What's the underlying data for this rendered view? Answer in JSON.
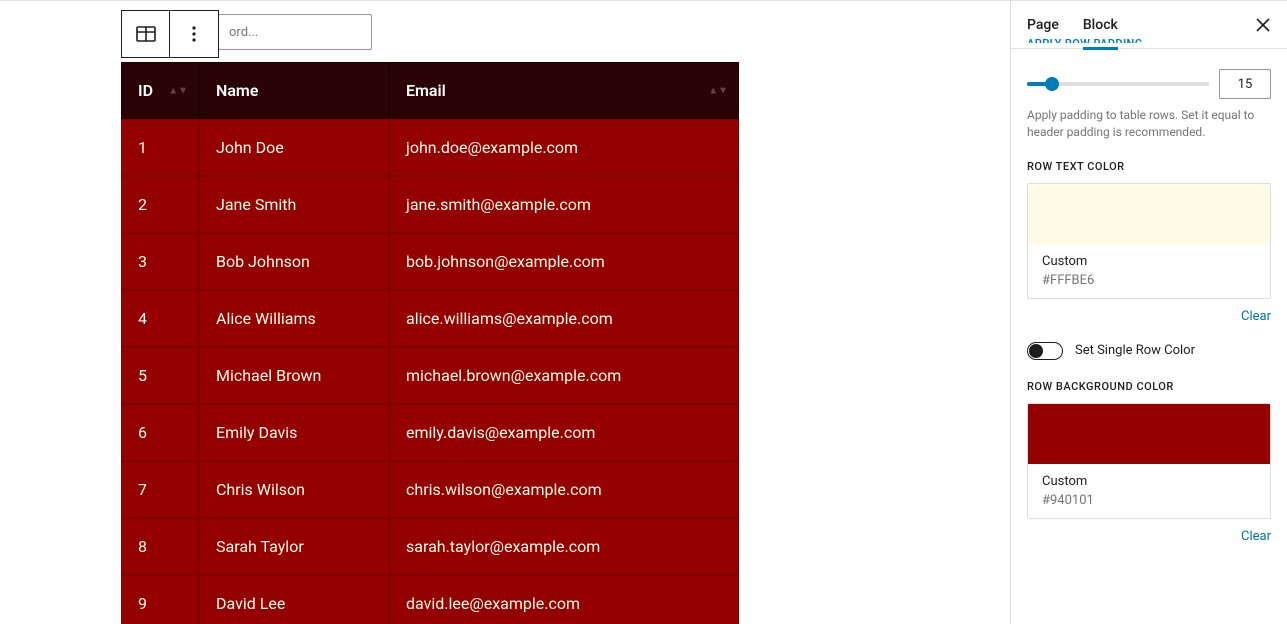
{
  "search": {
    "placeholder": "ord..."
  },
  "table": {
    "headers": {
      "id": "ID",
      "name": "Name",
      "email": "Email"
    },
    "rows": [
      {
        "id": "1",
        "name": "John Doe",
        "email": "john.doe@example.com"
      },
      {
        "id": "2",
        "name": "Jane Smith",
        "email": "jane.smith@example.com"
      },
      {
        "id": "3",
        "name": "Bob Johnson",
        "email": "bob.johnson@example.com"
      },
      {
        "id": "4",
        "name": "Alice Williams",
        "email": "alice.williams@example.com"
      },
      {
        "id": "5",
        "name": "Michael Brown",
        "email": "michael.brown@example.com"
      },
      {
        "id": "6",
        "name": "Emily Davis",
        "email": "emily.davis@example.com"
      },
      {
        "id": "7",
        "name": "Chris Wilson",
        "email": "chris.wilson@example.com"
      },
      {
        "id": "8",
        "name": "Sarah Taylor",
        "email": "sarah.taylor@example.com"
      },
      {
        "id": "9",
        "name": "David Lee",
        "email": "david.lee@example.com"
      }
    ]
  },
  "sidebar": {
    "tabs": {
      "page": "Page",
      "block": "Block"
    },
    "row_padding": {
      "value": "15",
      "help": "Apply padding to table rows. Set it equal to header padding is recommended."
    },
    "row_text_color": {
      "section": "ROW TEXT COLOR",
      "custom_label": "Custom",
      "hex": "#FFFBE6",
      "swatch": "#FFFBE6",
      "clear": "Clear"
    },
    "single_row_toggle": {
      "label": "Set Single Row Color"
    },
    "row_bg_color": {
      "section": "ROW BACKGROUND COLOR",
      "custom_label": "Custom",
      "hex": "#940101",
      "swatch": "#940101",
      "clear": "Clear"
    }
  }
}
